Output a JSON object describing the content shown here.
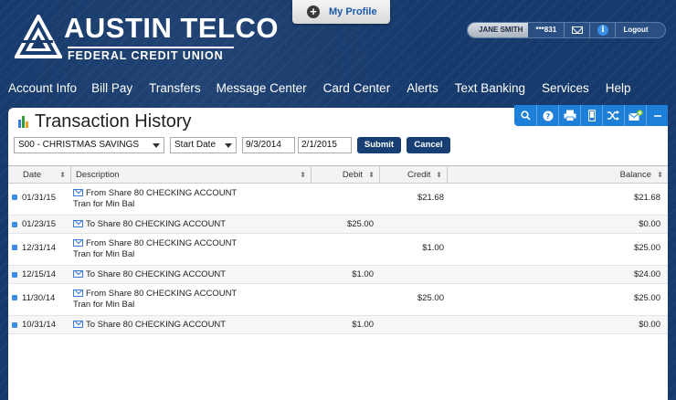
{
  "brand": {
    "name": "AUSTIN TELCO",
    "subtitle": "FEDERAL CREDIT UNION"
  },
  "profile_tab": {
    "label": "My Profile",
    "icon": "plus-circle-icon"
  },
  "userbar": {
    "name": "JANE SMITH",
    "account": "***831",
    "mail_icon": "envelope-icon",
    "info_icon": "info-icon",
    "logout": "Logout"
  },
  "nav": [
    {
      "label": "Account Info"
    },
    {
      "label": "Bill Pay"
    },
    {
      "label": "Transfers"
    },
    {
      "label": "Message Center"
    },
    {
      "label": "Card Center"
    },
    {
      "label": "Alerts"
    },
    {
      "label": "Text Banking"
    },
    {
      "label": "Services"
    },
    {
      "label": "Help"
    }
  ],
  "panel": {
    "title": "Transaction History",
    "title_icon": "bar-chart-icon"
  },
  "toolbar": [
    "search-icon",
    "help-icon",
    "print-icon",
    "mobile-icon",
    "shuffle-icon",
    "mail-add-icon",
    "minimize-icon"
  ],
  "filters": {
    "account": "S00 - CHRISTMAS SAVINGS",
    "date_type": "Start Date",
    "start": "9/3/2014",
    "end": "2/1/2015",
    "submit": "Submit",
    "cancel": "Cancel"
  },
  "columns": {
    "date": "Date",
    "description": "Description",
    "debit": "Debit",
    "credit": "Credit",
    "balance": "Balance"
  },
  "transactions": [
    {
      "date": "01/31/15",
      "desc": "From Share 80 CHECKING ACCOUNT",
      "sub": "Tran for Min Bal",
      "debit": "",
      "credit": "$21.68",
      "balance": "$21.68"
    },
    {
      "date": "01/23/15",
      "desc": "To Share 80 CHECKING ACCOUNT",
      "sub": "",
      "debit": "$25.00",
      "credit": "",
      "balance": "$0.00"
    },
    {
      "date": "12/31/14",
      "desc": "From Share 80 CHECKING ACCOUNT",
      "sub": "Tran for Min Bal",
      "debit": "",
      "credit": "$1.00",
      "balance": "$25.00"
    },
    {
      "date": "12/15/14",
      "desc": "To Share 80 CHECKING ACCOUNT",
      "sub": "",
      "debit": "$1.00",
      "credit": "",
      "balance": "$24.00"
    },
    {
      "date": "11/30/14",
      "desc": "From Share 80 CHECKING ACCOUNT",
      "sub": "Tran for Min Bal",
      "debit": "",
      "credit": "$25.00",
      "balance": "$25.00"
    },
    {
      "date": "10/31/14",
      "desc": "To Share 80 CHECKING ACCOUNT",
      "sub": "",
      "debit": "$1.00",
      "credit": "",
      "balance": "$0.00"
    }
  ]
}
